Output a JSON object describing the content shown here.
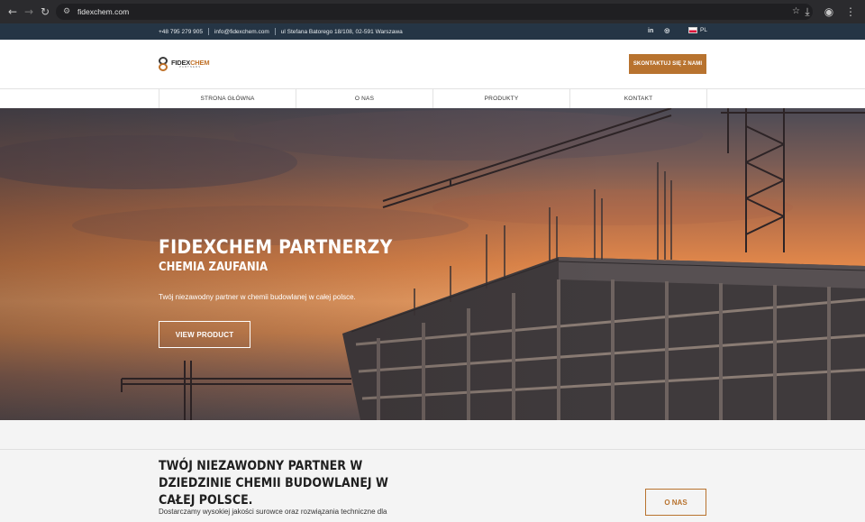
{
  "browser": {
    "url": "fidexchem.com",
    "icons": [
      "back-icon",
      "forward-icon",
      "reload-icon",
      "site-settings-icon",
      "bookmark-star-icon",
      "download-icon",
      "profile-icon",
      "menu-icon"
    ]
  },
  "topbar": {
    "phone": "+48 795 279 905",
    "email": "info@fidexchem.com",
    "address": "ul Stefana Batorego 18/108, 02-591 Warszawa",
    "social": [
      "in",
      "◎"
    ],
    "language": "PL"
  },
  "header": {
    "logo": {
      "name_dark": "FIDEX",
      "name_accent": "CHEM",
      "tagline": "PARTNERS"
    },
    "cta_label": "SKONTAKTUJ SIĘ Z NAMI"
  },
  "nav": {
    "items": [
      "STRONA GŁÓWNA",
      "O NAS",
      "PRODUKTY",
      "KONTAKT"
    ]
  },
  "hero": {
    "title": "FIDEXCHEM PARTNERZY",
    "subtitle": "CHEMIA ZAUFANIA",
    "text": "Twój niezawodny partner w chemii budowlanej w całej polsce.",
    "button_label": "VIEW PRODUCT"
  },
  "about": {
    "title": "TWÓJ NIEZAWODNY PARTNER W DZIEDZINIE CHEMII BUDOWLANEJ W CAŁEJ POLSCE.",
    "text": "Dostarczamy wysokiej jakości surowce oraz rozwiązania techniczne dla",
    "button_label": "O NAS"
  },
  "colors": {
    "topbar_bg": "#253545",
    "accent": "#b8732f",
    "chrome_bg": "#2b2b2e"
  }
}
